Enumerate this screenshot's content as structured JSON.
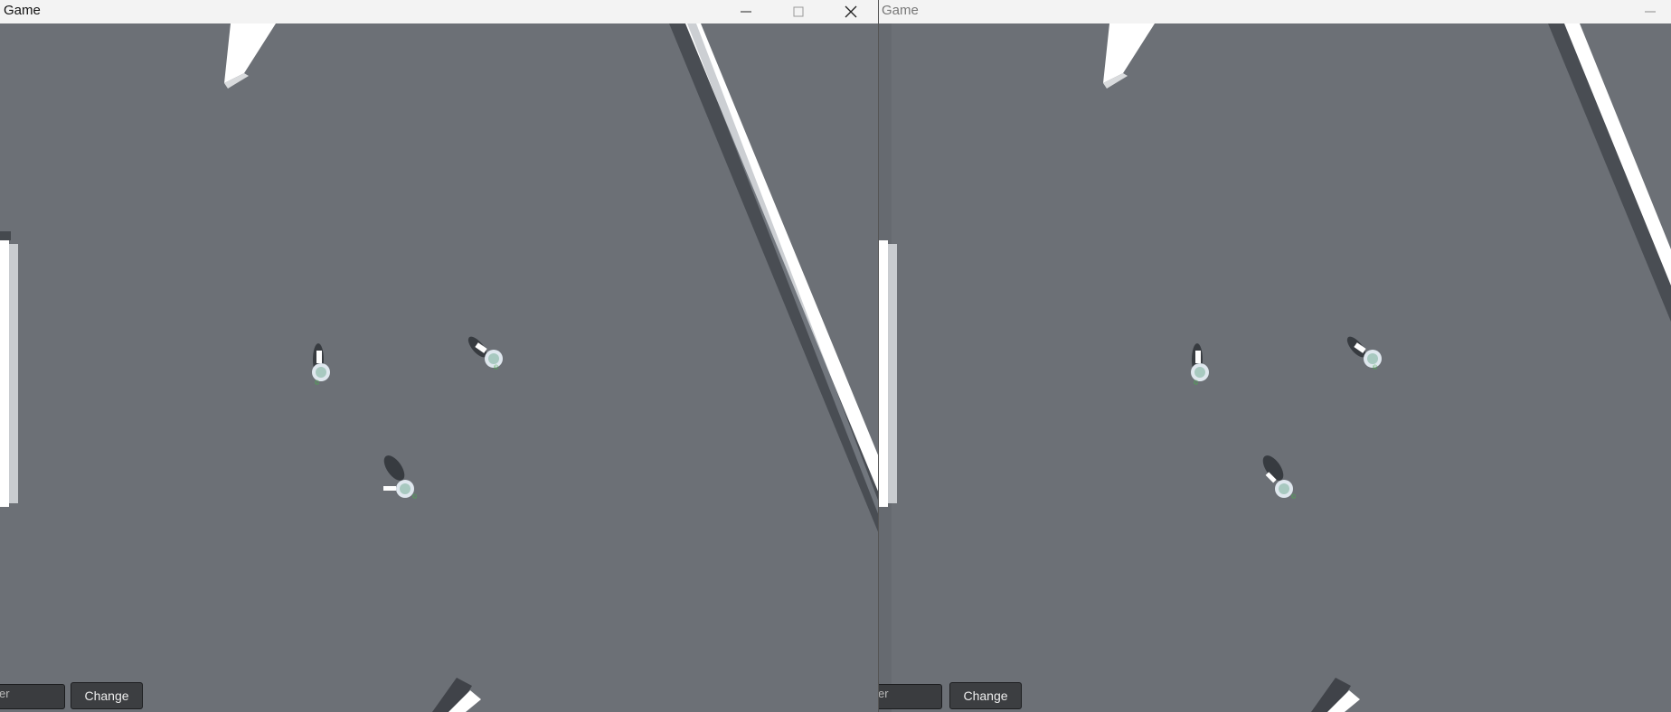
{
  "windows": [
    {
      "title": "Game",
      "controls": {
        "minimize": "minimize-icon",
        "maximize": "maximize-icon",
        "close": "close-icon"
      },
      "input": {
        "visible_text": "er"
      },
      "button": {
        "label": "Change"
      }
    },
    {
      "title": "Game",
      "controls": {
        "minimize": "minimize-icon"
      },
      "input": {
        "visible_text": "er"
      },
      "button": {
        "label": "Change"
      }
    }
  ],
  "colors": {
    "ground": "#6c7076",
    "wall": "#ffffff",
    "titlebar": "#f3f3f3",
    "player_marker": "#4caf50"
  }
}
